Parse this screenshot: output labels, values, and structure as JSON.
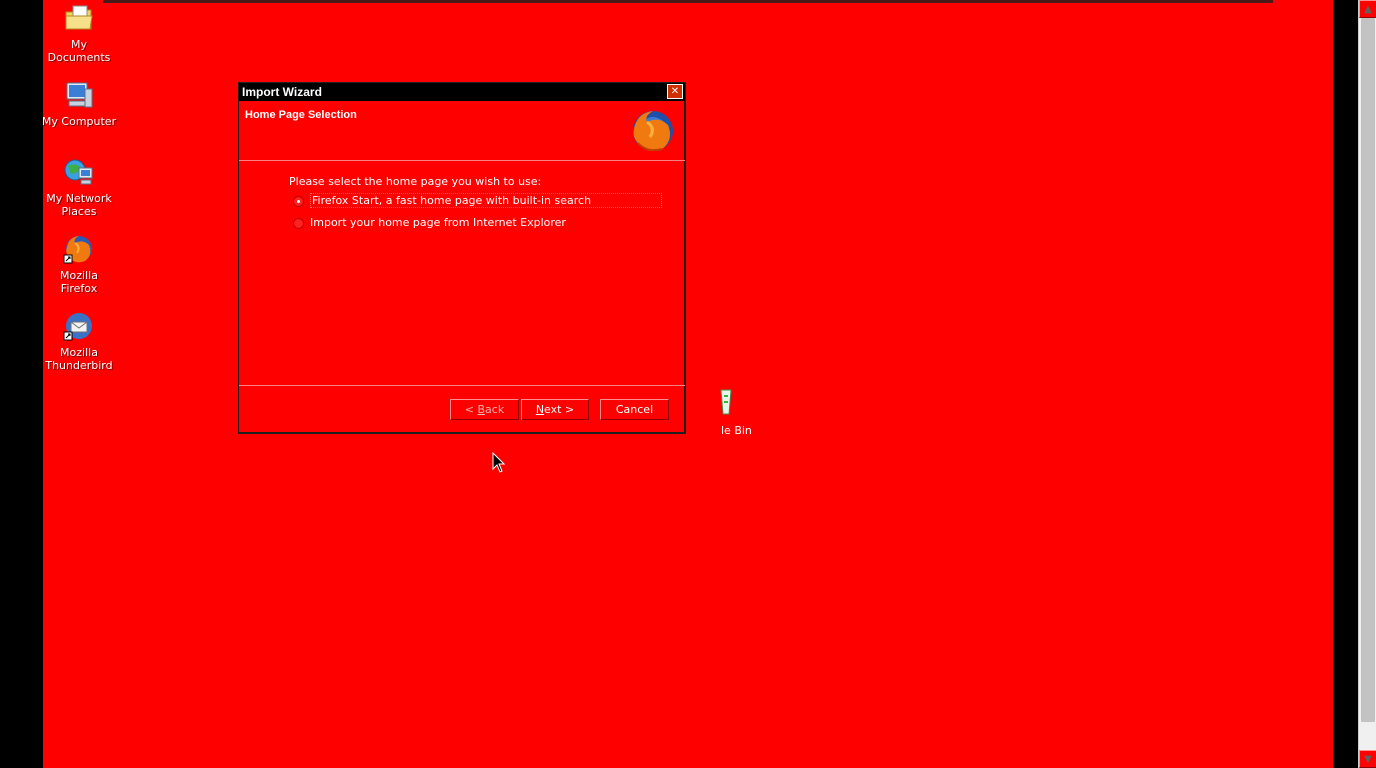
{
  "desktop": {
    "icons": [
      {
        "label": "My Documents",
        "icon": "folder-documents-icon"
      },
      {
        "label": "My Computer",
        "icon": "computer-icon"
      },
      {
        "label": "My Network Places",
        "icon": "network-icon"
      },
      {
        "label": "Mozilla Firefox",
        "icon": "firefox-icon"
      },
      {
        "label": "Mozilla Thunderbird",
        "icon": "thunderbird-icon"
      }
    ],
    "recycle_bin_label": "le Bin",
    "background_color": "#ff0000"
  },
  "dialog": {
    "title": "Import Wizard",
    "close_glyph": "✕",
    "heading": "Home Page Selection",
    "prompt": "Please select the home page you wish to use:",
    "options": [
      {
        "label": "Firefox Start, a fast home page with built-in search",
        "selected": true
      },
      {
        "label": "Import your home page from Internet Explorer",
        "selected": false
      }
    ],
    "buttons": {
      "back": {
        "prefix": "< ",
        "accel": "B",
        "rest": "ack"
      },
      "next": {
        "accel": "N",
        "rest": "ext >"
      },
      "cancel": "Cancel"
    }
  },
  "scrollbar": {
    "up_glyph": "▲",
    "down_glyph": "▼"
  }
}
